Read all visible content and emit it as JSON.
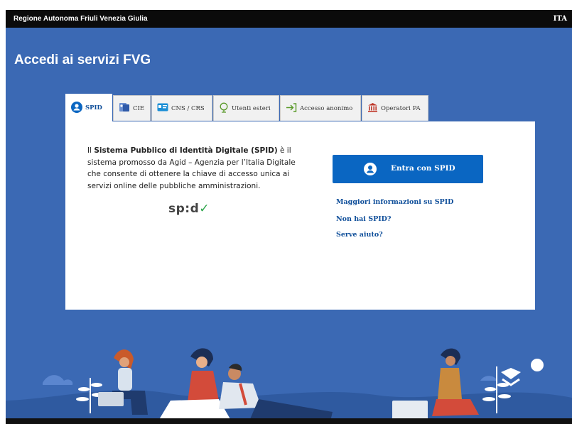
{
  "topbar": {
    "org": "Regione Autonoma Friuli Venezia Giulia",
    "lang": "ITA"
  },
  "title": "Accedi ai servizi FVG",
  "tabs": [
    {
      "label": "SPID",
      "icon": "user-circle-icon"
    },
    {
      "label": "CIE",
      "icon": "id-card-icon"
    },
    {
      "label": "CNS / CRS",
      "icon": "card-icon"
    },
    {
      "label": "Utenti esteri",
      "icon": "globe-icon"
    },
    {
      "label": "Accesso anonimo",
      "icon": "login-arrow-icon"
    },
    {
      "label": "Operatori PA",
      "icon": "building-icon"
    }
  ],
  "panel": {
    "desc_pre": "Il ",
    "desc_bold": "Sistema Pubblico di Identità Digitale (SPID)",
    "desc_post": " è il sistema promosso da Agid – Agenzia per l’Italia Digitale che consente di ottenere la chiave di accesso unica ai servizi online delle pubbliche amministrazioni.",
    "logo_text": "sp:d",
    "button_label": "Entra con SPID",
    "links": [
      "Maggiori informazioni su SPID",
      "Non hai SPID?",
      "Serve aiuto?"
    ]
  }
}
